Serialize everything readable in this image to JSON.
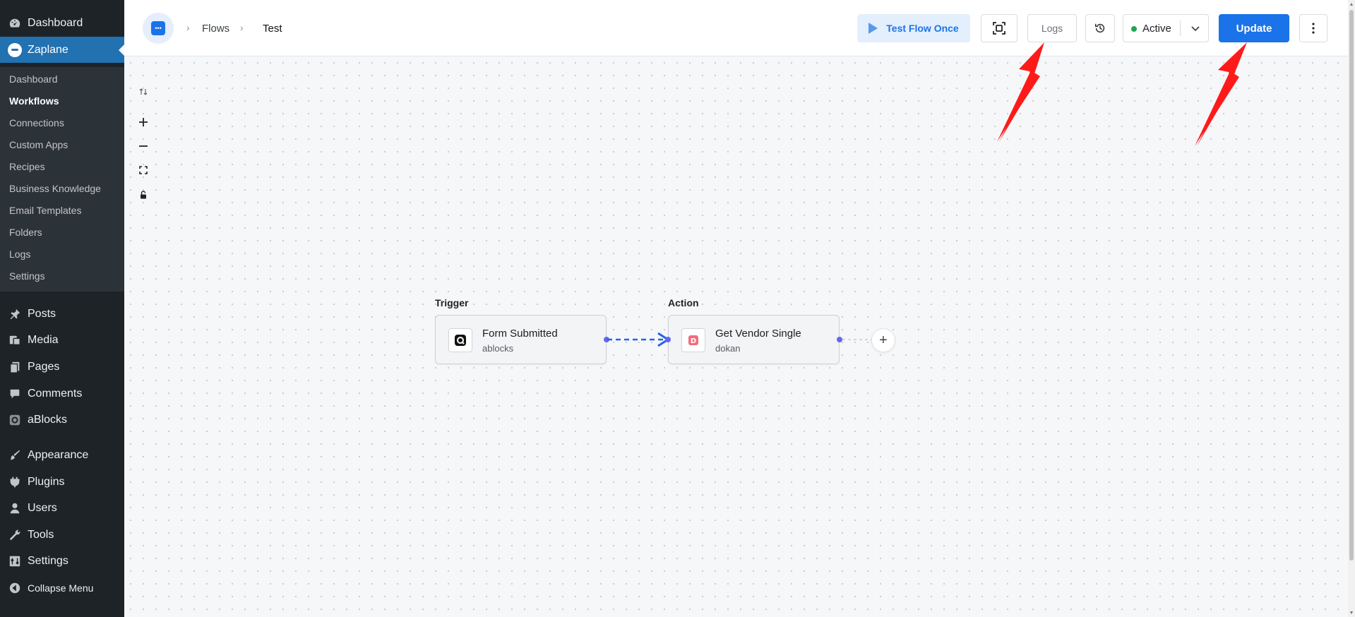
{
  "sidebar": {
    "top": [
      {
        "label": "Dashboard",
        "icon": "dashboard-icon"
      },
      {
        "label": "Zaplane",
        "icon": "zaplane-icon"
      }
    ],
    "submenu": [
      "Dashboard",
      "Workflows",
      "Connections",
      "Custom Apps",
      "Recipes",
      "Business Knowledge",
      "Email Templates",
      "Folders",
      "Logs",
      "Settings"
    ],
    "bottom": [
      {
        "label": "Posts",
        "icon": "pin-icon"
      },
      {
        "label": "Media",
        "icon": "media-icon"
      },
      {
        "label": "Pages",
        "icon": "pages-icon"
      },
      {
        "label": "Comments",
        "icon": "comment-icon"
      },
      {
        "label": "aBlocks",
        "icon": "ablocks-icon"
      },
      {
        "label": "Appearance",
        "icon": "brush-icon"
      },
      {
        "label": "Plugins",
        "icon": "plug-icon"
      },
      {
        "label": "Users",
        "icon": "user-icon"
      },
      {
        "label": "Tools",
        "icon": "wrench-icon"
      },
      {
        "label": "Settings",
        "icon": "settings-icon"
      },
      {
        "label": "Collapse Menu",
        "icon": "collapse-icon"
      }
    ]
  },
  "header": {
    "breadcrumb": [
      "Flows",
      "Test"
    ],
    "test_flow_label": "Test Flow Once",
    "logs_label": "Logs",
    "status_label": "Active",
    "update_label": "Update"
  },
  "canvas": {
    "controls": [
      "sort-icon",
      "zoom-in-icon",
      "zoom-out-icon",
      "fit-view-icon",
      "lock-icon"
    ],
    "nodes": [
      {
        "section": "Trigger",
        "title": "Form Submitted",
        "subtitle": "ablocks"
      },
      {
        "section": "Action",
        "title": "Get Vendor Single",
        "subtitle": "dokan"
      }
    ],
    "add_node_label": "+"
  },
  "colors": {
    "wp_sidebar": "#1d2327",
    "wp_accent": "#2271b1",
    "primary": "#1a73e8",
    "active_dot": "#22a750",
    "handle": "#6366f1",
    "annotation_arrow": "#ff1a1a"
  }
}
